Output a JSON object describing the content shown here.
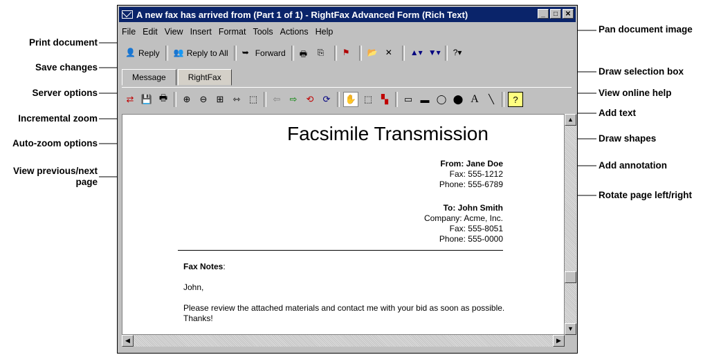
{
  "window": {
    "title": "A new fax has arrived from  (Part 1 of 1) - RightFax Advanced Form (Rich Text)"
  },
  "menu": [
    "File",
    "Edit",
    "View",
    "Insert",
    "Format",
    "Tools",
    "Actions",
    "Help"
  ],
  "toolbar1": {
    "reply": "Reply",
    "reply_all": "Reply to All",
    "forward": "Forward"
  },
  "tabs": [
    "Message",
    "RightFax"
  ],
  "doc": {
    "title": "Facsimile Transmission",
    "from": "From: Jane Doe",
    "from_fax": "Fax: 555-1212",
    "from_phone": "Phone: 555-6789",
    "to": "To: John Smith",
    "to_company": "Company: Acme, Inc.",
    "to_fax": "Fax: 555-8051",
    "to_phone": "Phone: 555-0000",
    "notes_label": "Fax Notes",
    "notes_colon": ":",
    "greeting": "John,",
    "message": "Please review the attached materials and contact me with your bid as soon as possible. Thanks!"
  },
  "callouts_left": {
    "print": "Print document",
    "save": "Save changes",
    "server": "Server options",
    "zoom": "Incremental zoom",
    "autozoom": "Auto-zoom options",
    "viewprev_1": "View previous/next",
    "viewprev_2": "page"
  },
  "callouts_right": {
    "pan": "Pan document image",
    "selbox": "Draw selection box",
    "help": "View online help",
    "addtext": "Add text",
    "shapes": "Draw shapes",
    "annot": "Add annotation",
    "rotate": "Rotate page left/right"
  },
  "colors": {
    "titlebar": "#0a246a",
    "chrome": "#c0c0c0"
  }
}
